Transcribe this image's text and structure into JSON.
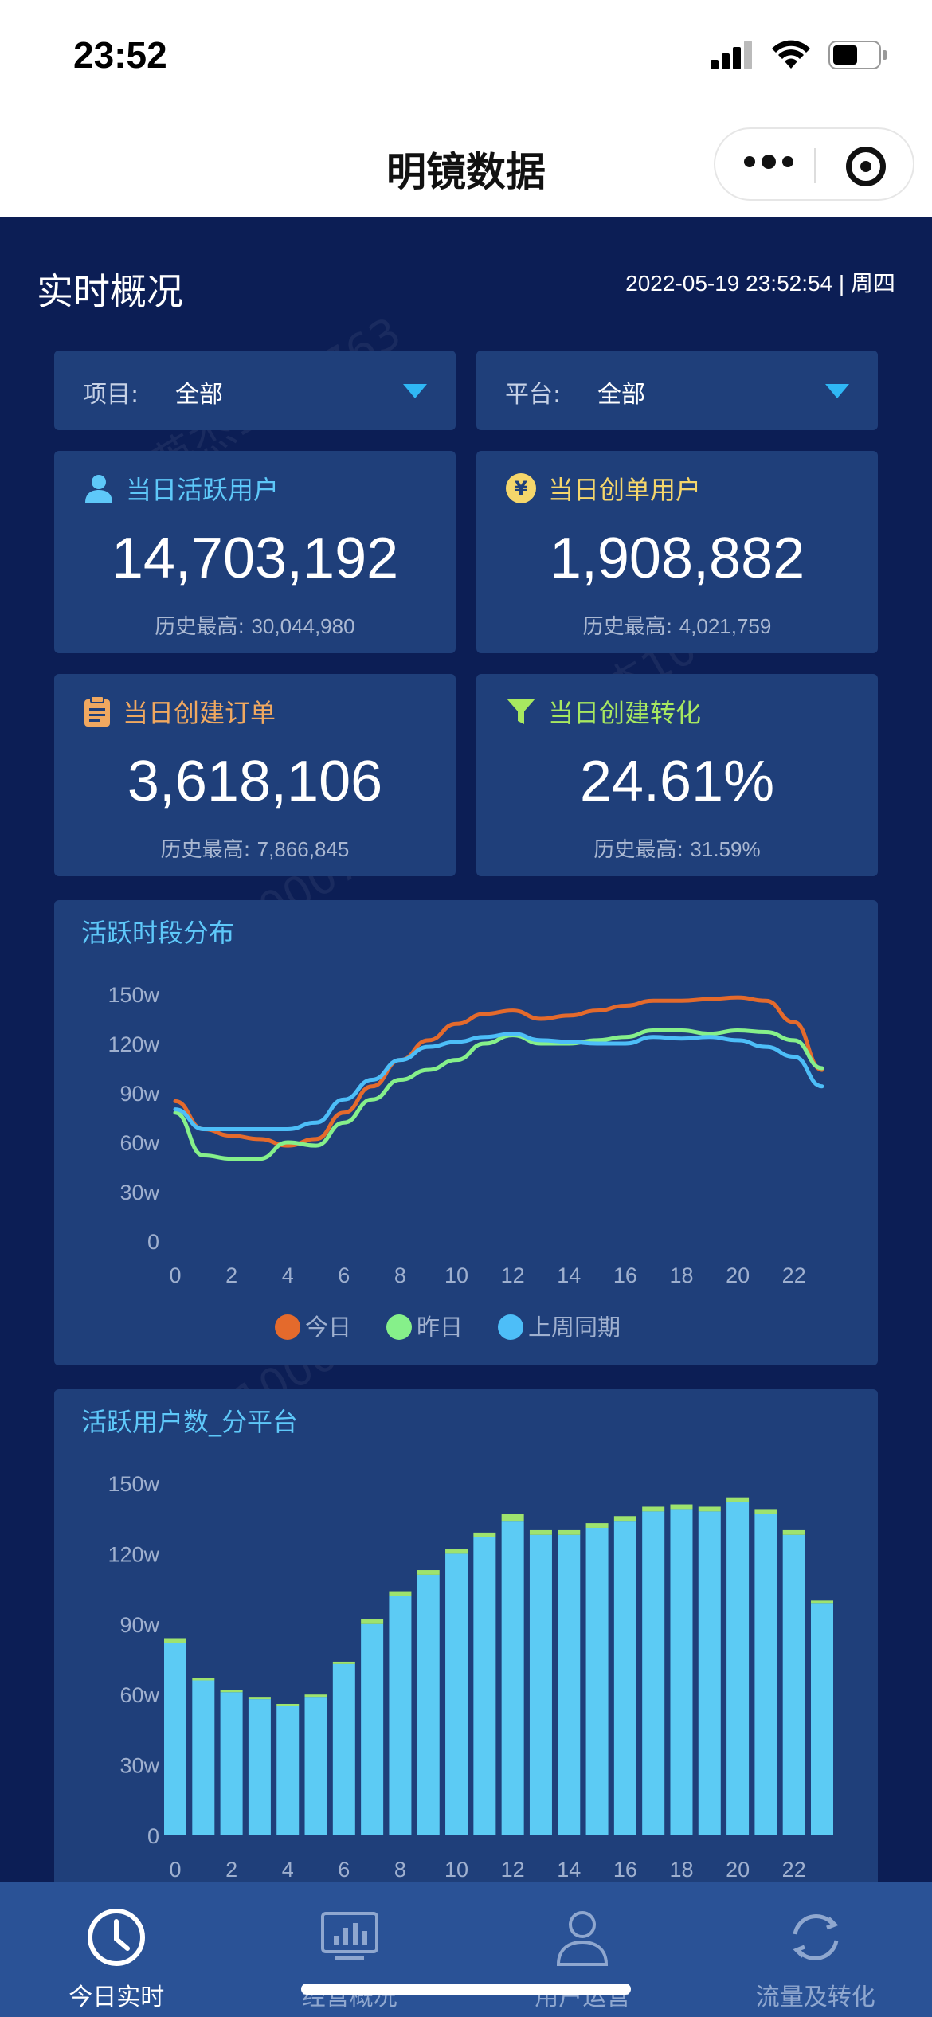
{
  "status_bar": {
    "time": "23:52"
  },
  "nav": {
    "title": "明镜数据"
  },
  "overview": {
    "title": "实时概况",
    "datetime": "2022-05-19 23:52:54 | 周四"
  },
  "filters": [
    {
      "label": "项目:",
      "value": "全部"
    },
    {
      "label": "平台:",
      "value": "全部"
    }
  ],
  "cards": [
    {
      "title": "当日活跃用户",
      "value": "14,703,192",
      "hist_label": "历史最高:",
      "hist_value": "30,044,980",
      "icon": "user-icon",
      "color": "#5ec8f9"
    },
    {
      "title": "当日创单用户",
      "value": "1,908,882",
      "hist_label": "历史最高:",
      "hist_value": "4,021,759",
      "icon": "yen-icon",
      "color": "#f5d66b"
    },
    {
      "title": "当日创建订单",
      "value": "3,618,106",
      "hist_label": "历史最高:",
      "hist_value": "7,866,845",
      "icon": "clipboard-icon",
      "color": "#f0a860"
    },
    {
      "title": "当日创建转化",
      "value": "24.61%",
      "hist_label": "历史最高:",
      "hist_value": "31.59%",
      "icon": "funnel-icon",
      "color": "#a8e860"
    }
  ],
  "watermark": "谭英杰1000763",
  "chart_data": [
    {
      "type": "line",
      "title": "活跃时段分布",
      "x": [
        0,
        1,
        2,
        3,
        4,
        5,
        6,
        7,
        8,
        9,
        10,
        11,
        12,
        13,
        14,
        15,
        16,
        17,
        18,
        19,
        20,
        21,
        22,
        23
      ],
      "xticks": [
        "0",
        "2",
        "4",
        "6",
        "8",
        "10",
        "12",
        "14",
        "16",
        "18",
        "20",
        "22"
      ],
      "yticks": [
        "0",
        "30w",
        "60w",
        "90w",
        "120w",
        "150w"
      ],
      "ylim": [
        0,
        150
      ],
      "series": [
        {
          "name": "今日",
          "color": "#e46a2c",
          "values": [
            85,
            68,
            64,
            62,
            58,
            62,
            78,
            94,
            110,
            122,
            132,
            138,
            140,
            135,
            137,
            140,
            143,
            146,
            146,
            147,
            148,
            146,
            133,
            104
          ]
        },
        {
          "name": "昨日",
          "color": "#86f08a",
          "values": [
            78,
            52,
            50,
            50,
            60,
            58,
            72,
            86,
            98,
            104,
            110,
            120,
            125,
            120,
            120,
            122,
            124,
            128,
            128,
            126,
            128,
            127,
            122,
            105
          ]
        },
        {
          "name": "上周同期",
          "color": "#4dbef8",
          "values": [
            80,
            68,
            68,
            68,
            68,
            72,
            86,
            98,
            110,
            118,
            121,
            124,
            126,
            122,
            121,
            120,
            120,
            124,
            123,
            124,
            122,
            118,
            112,
            94
          ]
        }
      ],
      "legend": "bottom"
    },
    {
      "type": "bar",
      "title": "活跃用户数_分平台",
      "x": [
        0,
        1,
        2,
        3,
        4,
        5,
        6,
        7,
        8,
        9,
        10,
        11,
        12,
        13,
        14,
        15,
        16,
        17,
        18,
        19,
        20,
        21,
        22,
        23
      ],
      "xticks": [
        "0",
        "2",
        "4",
        "6",
        "8",
        "10",
        "12",
        "14",
        "16",
        "18",
        "20",
        "22"
      ],
      "yticks": [
        "0",
        "30w",
        "60w",
        "90w",
        "120w",
        "150w"
      ],
      "ylim": [
        0,
        150
      ],
      "stacked": true,
      "series": [
        {
          "color": "#5ccbf4",
          "values": [
            82,
            66,
            61,
            58,
            55,
            59,
            73,
            90,
            102,
            111,
            120,
            127,
            134,
            128,
            128,
            131,
            134,
            138,
            139,
            138,
            142,
            137,
            128,
            99
          ]
        },
        {
          "color": "#9ee36e",
          "values": [
            2,
            1,
            1,
            1,
            1,
            1,
            1,
            2,
            2,
            2,
            2,
            2,
            3,
            2,
            2,
            2,
            2,
            2,
            2,
            2,
            2,
            2,
            2,
            1
          ]
        }
      ]
    }
  ],
  "tabs": [
    {
      "label": "今日实时",
      "icon": "clock-icon",
      "active": true
    },
    {
      "label": "经营概况",
      "icon": "monitor-chart-icon",
      "active": false
    },
    {
      "label": "用户运营",
      "icon": "user-outline-icon",
      "active": false
    },
    {
      "label": "流量及转化",
      "icon": "refresh-icon",
      "active": false
    }
  ]
}
